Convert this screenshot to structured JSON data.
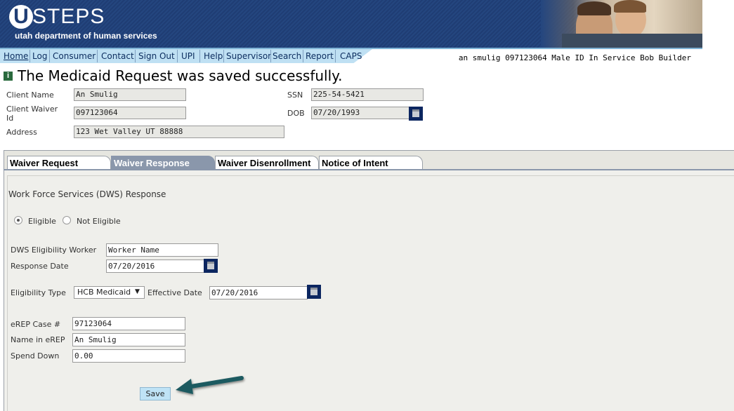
{
  "header": {
    "logo_letter": "U",
    "logo_text": "STEPS",
    "subtitle": "utah department of human services"
  },
  "nav": {
    "items": [
      "Home",
      "Log",
      "Consumer",
      "Contact",
      "Sign Out",
      "UPI",
      "Help",
      "Supervisor",
      "Search",
      "Report",
      "CAPS"
    ],
    "status": "an smulig 097123064 Male ID In Service Bob Builder"
  },
  "message": {
    "icon": "info-icon",
    "text": "The Medicaid Request was saved successfully."
  },
  "client": {
    "name_label": "Client Name",
    "name_value": "An Smulig",
    "waiver_label_1": "Client Waiver",
    "waiver_label_2": "Id",
    "waiver_value": "097123064",
    "address_label": "Address",
    "address_value": "123 Wet Valley UT 88888",
    "ssn_label": "SSN",
    "ssn_value": "225-54-5421",
    "dob_label": "DOB",
    "dob_value": "07/20/1993"
  },
  "tabs": [
    {
      "label": "Waiver Request",
      "active": false
    },
    {
      "label": "Waiver Response",
      "active": true
    },
    {
      "label": "Waiver Disenrollment",
      "active": false
    },
    {
      "label": "Notice of Intent",
      "active": false
    }
  ],
  "response": {
    "section_title": "Work Force Services (DWS) Response",
    "eligible_label": "Eligible",
    "not_eligible_label": "Not Eligible",
    "selected": "Eligible",
    "worker_label": "DWS Eligibility Worker",
    "worker_value": "Worker Name",
    "response_date_label": "Response Date",
    "response_date_value": "07/20/2016",
    "eligibility_type_label": "Eligibility Type",
    "eligibility_type_value": "HCB Medicaid",
    "effective_date_label": "Effective Date",
    "effective_date_value": "07/20/2016",
    "erep_case_label": "eREP Case #",
    "erep_case_value": "97123064",
    "name_in_erep_label": "Name in eREP",
    "name_in_erep_value": "An Smulig",
    "spend_down_label": "Spend Down",
    "spend_down_value": "0.00",
    "save_label": "Save"
  },
  "colors": {
    "banner": "#1f3d74",
    "nav_strip": "#bfe0f3",
    "active_tab": "#8a97ab",
    "save_button": "#bfe3f6",
    "arrow": "#1f5a60"
  }
}
